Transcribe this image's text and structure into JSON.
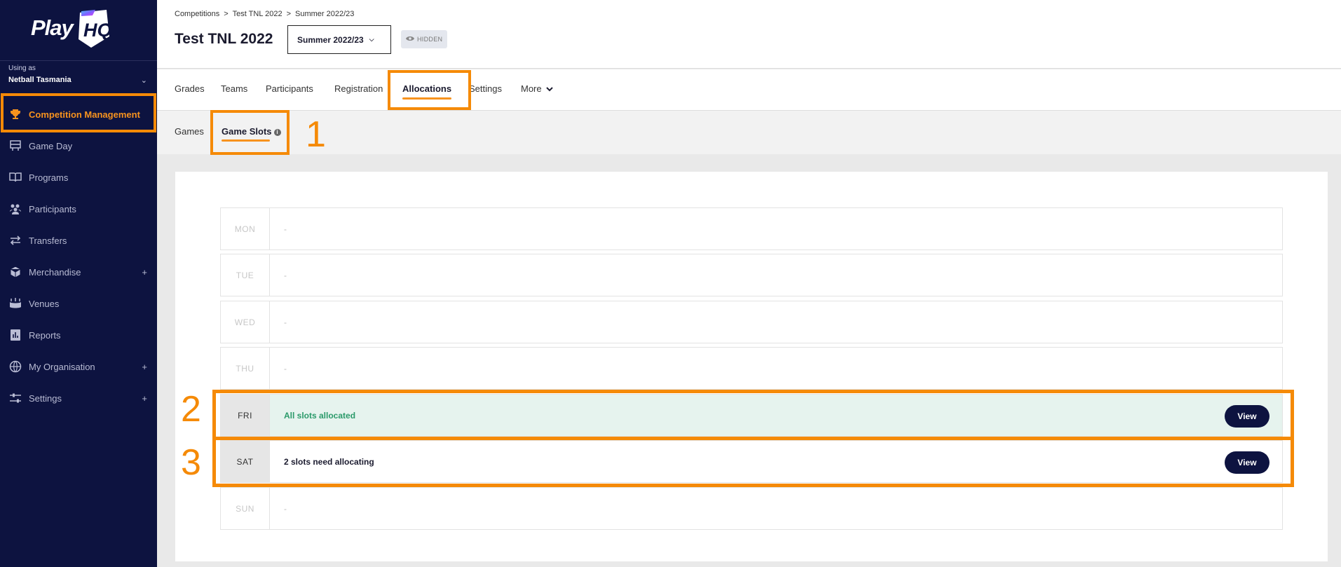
{
  "brand": {
    "logo_play": "Play",
    "logo_hq": "HQ",
    "accent": "#f7931e",
    "sidebar_bg": "#0d1340"
  },
  "sidebar": {
    "using_as_label": "Using as",
    "organisation": "Netball Tasmania",
    "items": [
      {
        "label": "Competition Management",
        "icon": "trophy-icon",
        "active": true
      },
      {
        "label": "Game Day",
        "icon": "scoreboard-icon"
      },
      {
        "label": "Programs",
        "icon": "book-icon"
      },
      {
        "label": "Participants",
        "icon": "people-icon"
      },
      {
        "label": "Transfers",
        "icon": "transfer-arrows-icon"
      },
      {
        "label": "Merchandise",
        "icon": "box-icon",
        "expandable": true
      },
      {
        "label": "Venues",
        "icon": "stadium-icon"
      },
      {
        "label": "Reports",
        "icon": "report-icon"
      },
      {
        "label": "My Organisation",
        "icon": "globe-icon",
        "expandable": true
      },
      {
        "label": "Settings",
        "icon": "sliders-icon",
        "expandable": true
      }
    ],
    "plus": "+"
  },
  "header": {
    "breadcrumb": [
      "Competitions",
      "Test TNL 2022",
      "Summer 2022/23"
    ],
    "breadcrumb_sep": ">",
    "title": "Test TNL 2022",
    "season_select": "Summer 2022/23",
    "hidden_badge": "HIDDEN"
  },
  "tabs": [
    "Grades",
    "Teams",
    "Participants",
    "Registration",
    "Allocations",
    "Settings",
    "More"
  ],
  "active_tab": "Allocations",
  "subtabs": [
    "Games",
    "Game Slots"
  ],
  "active_subtab": "Game Slots",
  "annotations": [
    "1",
    "2",
    "3"
  ],
  "days": [
    {
      "day": "MON",
      "value": "-"
    },
    {
      "day": "TUE",
      "value": "-"
    },
    {
      "day": "WED",
      "value": "-"
    },
    {
      "day": "THU",
      "value": "-"
    },
    {
      "day": "FRI",
      "value": "All slots allocated",
      "button": "View",
      "status": "allocated"
    },
    {
      "day": "SAT",
      "value": "2 slots need allocating",
      "button": "View",
      "status": "pending"
    },
    {
      "day": "SUN",
      "value": "-"
    }
  ]
}
